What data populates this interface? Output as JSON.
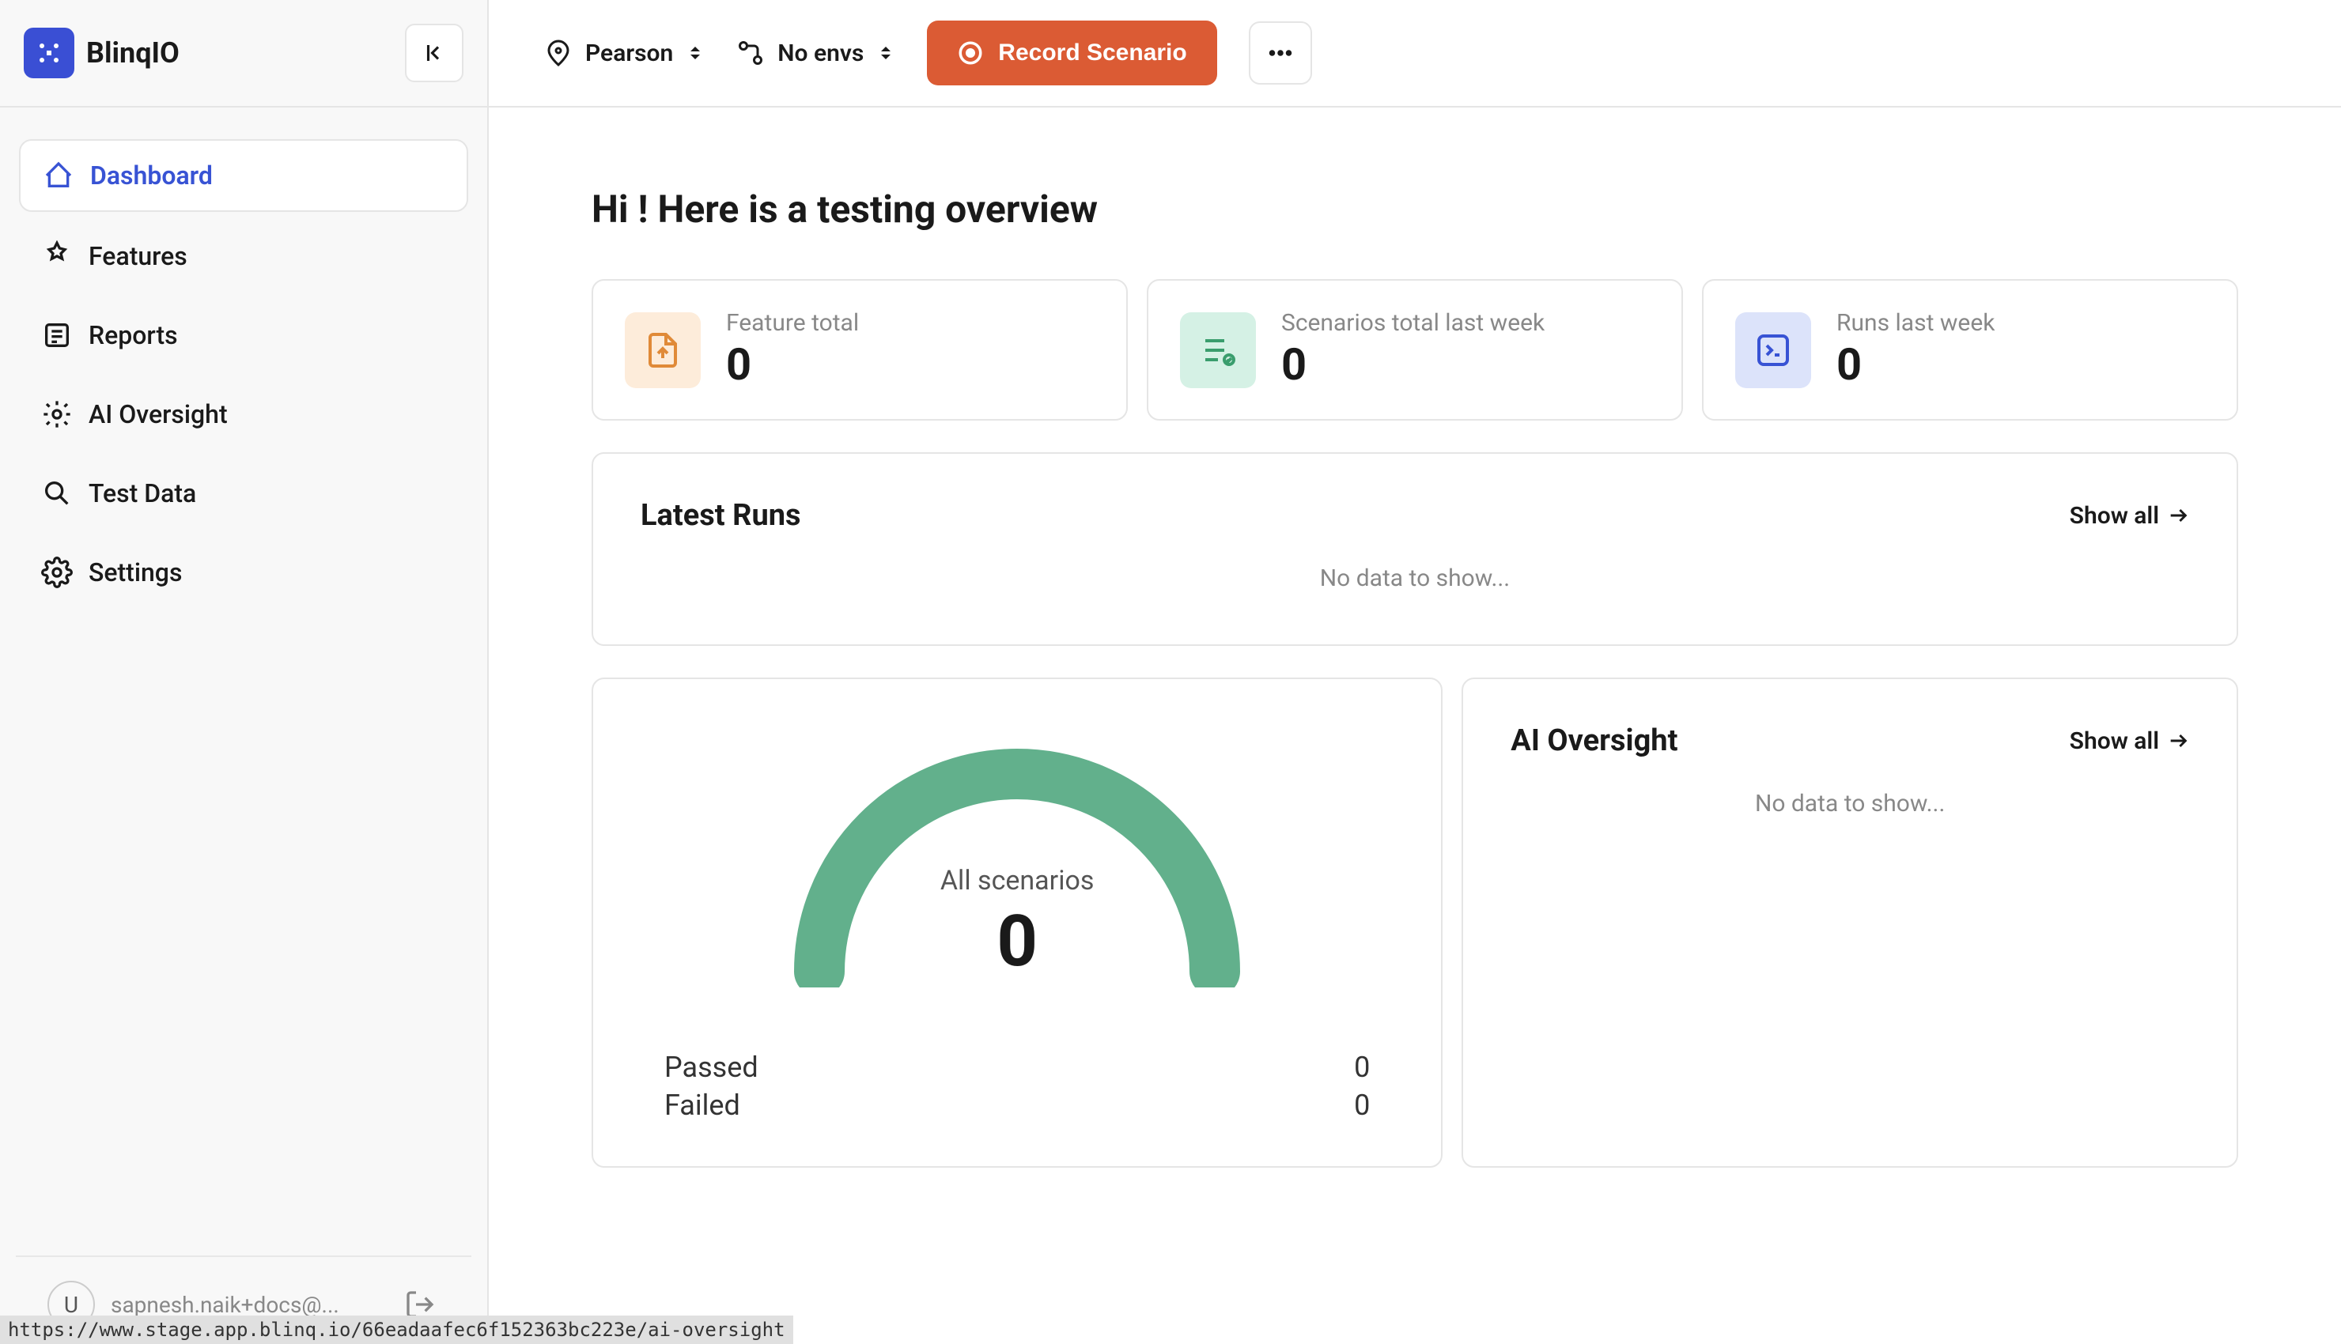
{
  "brand": {
    "name": "BlinqIO"
  },
  "sidebar": {
    "items": [
      {
        "label": "Dashboard"
      },
      {
        "label": "Features"
      },
      {
        "label": "Reports"
      },
      {
        "label": "AI Oversight"
      },
      {
        "label": "Test Data"
      },
      {
        "label": "Settings"
      }
    ]
  },
  "user": {
    "initial": "U",
    "email": "sapnesh.naik+docs@..."
  },
  "topbar": {
    "project_selector": "Pearson",
    "env_selector": "No envs",
    "record_button": "Record Scenario"
  },
  "dashboard": {
    "title": "Hi ! Here is a testing overview",
    "stats": {
      "feature_total_label": "Feature total",
      "feature_total_value": "0",
      "scenarios_week_label": "Scenarios total last week",
      "scenarios_week_value": "0",
      "runs_week_label": "Runs last week",
      "runs_week_value": "0"
    },
    "latest_runs": {
      "title": "Latest Runs",
      "show_all": "Show all",
      "empty": "No data to show..."
    },
    "gauge": {
      "label": "All scenarios",
      "value": "0",
      "passed_label": "Passed",
      "passed_value": "0",
      "failed_label": "Failed",
      "failed_value": "0"
    },
    "ai_oversight": {
      "title": "AI Oversight",
      "show_all": "Show all",
      "empty": "No data to show..."
    }
  },
  "status_url": "https://www.stage.app.blinq.io/66eadaafec6f152363bc223e/ai-oversight",
  "chart_data": {
    "type": "pie",
    "title": "All scenarios",
    "total": 0,
    "series": [
      {
        "name": "Passed",
        "value": 0
      },
      {
        "name": "Failed",
        "value": 0
      }
    ]
  }
}
